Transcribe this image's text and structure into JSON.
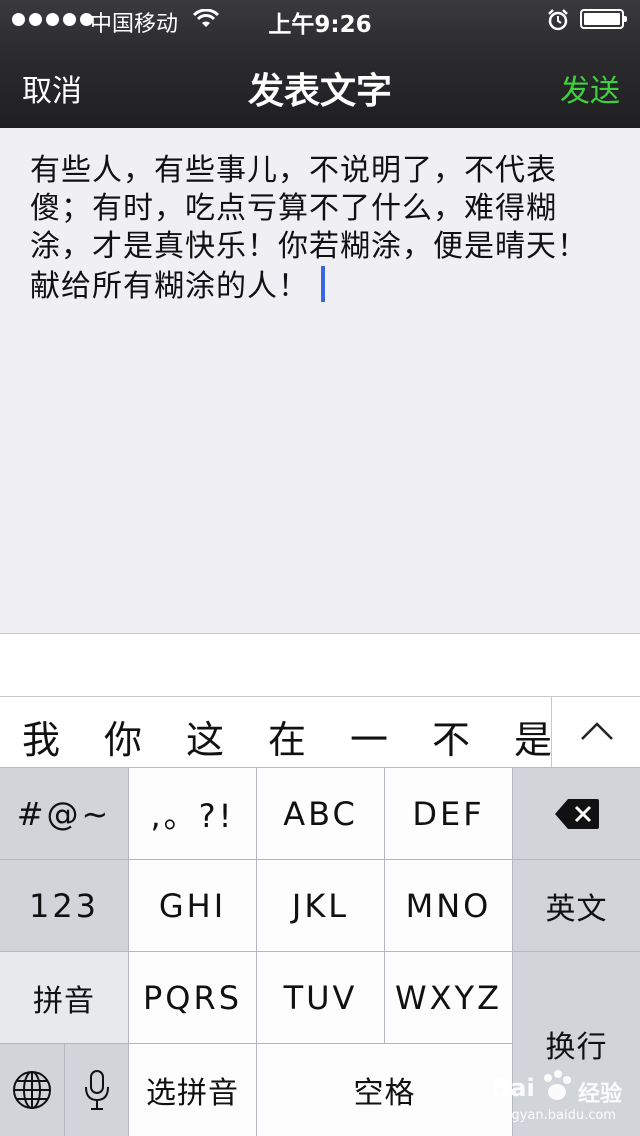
{
  "status_bar": {
    "carrier": "中国移动",
    "time": "上午9:26",
    "signal_icon": "signal-dots-icon",
    "wifi_icon": "wifi-icon",
    "alarm_icon": "alarm-icon",
    "battery_icon": "battery-icon",
    "battery_level": 1.0
  },
  "nav": {
    "cancel": "取消",
    "title": "发表文字",
    "send": "发送",
    "send_color": "#3fd03f"
  },
  "compose": {
    "lines": [
      "有些人，有些事儿，不说明了，不代表",
      "傻；有时，吃点亏算不了什么，难得糊",
      "涂，才是真快乐！你若糊涂，便是晴天！",
      "献给所有糊涂的人！"
    ]
  },
  "candidates": [
    "我",
    "你",
    "这",
    "在",
    "一",
    "不",
    "是"
  ],
  "keyboard": {
    "symbols": "#@~",
    "punct": ",。?!",
    "abc": "ABC",
    "def": "DEF",
    "num": "123",
    "ghi": "GHI",
    "jkl": "JKL",
    "mno": "MNO",
    "english": "英文",
    "pinyin": "拼音",
    "pqrs": "PQRS",
    "tuv": "TUV",
    "wxyz": "WXYZ",
    "enter": "换行",
    "select_pinyin": "选拼音",
    "space": "空格",
    "globe_icon": "globe-icon",
    "mic_icon": "microphone-icon",
    "delete_icon": "backspace-icon",
    "collapse_icon": "chevron-up-icon"
  },
  "watermark": {
    "main": "Bai",
    "cn": "经验",
    "sub": "jingyan.baidu.com"
  }
}
